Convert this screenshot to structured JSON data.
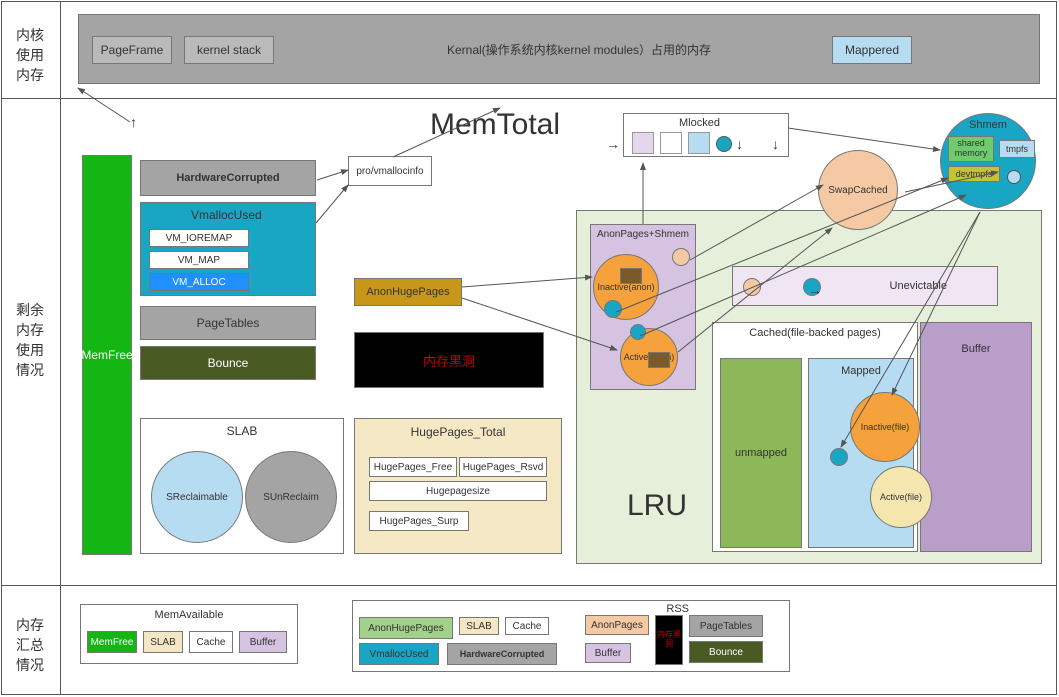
{
  "rows": {
    "kernel_label": "内核\n使用\n内存",
    "remain_label": "剩余\n内存\n使用\n情况",
    "summary_label": "内存\n汇总\n情况"
  },
  "top": {
    "title": "Kernal(操作系统内核kernel modules）占用的内存",
    "pageframe": "PageFrame",
    "kernelstack": "kernel stack",
    "mappered": "Mappered"
  },
  "memtotal": "MemTotal",
  "mlocked": "Mlocked",
  "shmem": {
    "title": "Shmem",
    "shared": "shared memory",
    "tmpfs": "tmpfs",
    "devtmpfs": "devtmpfs"
  },
  "left": {
    "memfree": "MemFree",
    "hardwarecorrupted": "HardwareCorrupted",
    "vmallocused": "VmallocUsed",
    "vm_ioremap": "VM_IOREMAP",
    "vm_map": "VM_MAP",
    "vm_alloc": "VM_ALLOC",
    "pagetables": "PageTables",
    "bounce": "Bounce",
    "provmallocinfo": "pro/vmallocinfo"
  },
  "mid": {
    "anonhugepages": "AnonHugePages",
    "blackhole": "内存黑洞"
  },
  "slab": {
    "title": "SLAB",
    "sreclaim": "SReclaimable",
    "sunreclaim": "SUnReclaim"
  },
  "hp": {
    "title": "HugePages_Total",
    "free": "HugePages_Free",
    "rsvd": "HugePages_Rsvd",
    "size": "Hugepagesize",
    "surp": "HugePages_Surp"
  },
  "lru": {
    "title": "LRU",
    "anonpages_shmem": "AnonPages+Shmem",
    "inactive_anon": "Inactive(anon)",
    "active_anon": "Active(anon)",
    "swapcached": "SwapCached",
    "unevictable": "Unevictable",
    "cached_title": "Cached(file-backed pages)",
    "unmapped": "unmapped",
    "mapped": "Mapped",
    "buffer": "Buffer",
    "inactive_file": "Inactive(file)",
    "active_file": "Active(file)"
  },
  "summary": {
    "memavail": {
      "title": "MemAvailable",
      "memfree": "MemFree",
      "slab": "SLAB",
      "cache": "Cache",
      "buffer": "Buffer"
    },
    "rss": {
      "title": "RSS",
      "anonhuge": "AnonHugePages",
      "slab": "SLAB",
      "cache": "Cache",
      "anonpages": "AnonPages",
      "vmalloc": "VmallocUsed",
      "hardwarecorrupted": "HardwareCorrupted",
      "buffer": "Buffer",
      "blackhole": "内存黑洞",
      "pagetables": "PageTables",
      "bounce": "Bounce"
    }
  }
}
